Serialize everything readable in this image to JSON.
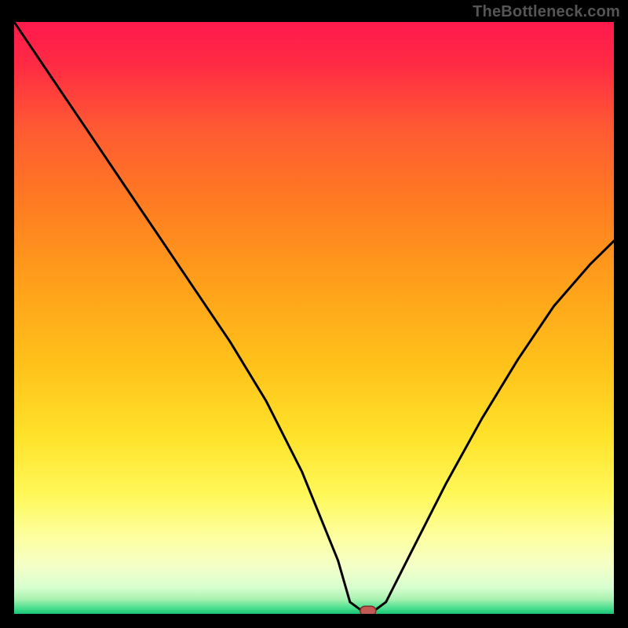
{
  "watermark": "TheBottleneck.com",
  "colors": {
    "frame_bg": "#000000",
    "watermark": "#555555",
    "curve": "#000000",
    "marker_fill": "#c15a55",
    "marker_stroke": "#7a2f2b"
  },
  "gradient_stops": [
    {
      "offset": 0.0,
      "color": "#ff1a4d"
    },
    {
      "offset": 0.07,
      "color": "#ff2a44"
    },
    {
      "offset": 0.18,
      "color": "#ff5a33"
    },
    {
      "offset": 0.3,
      "color": "#ff7a22"
    },
    {
      "offset": 0.45,
      "color": "#ffa21a"
    },
    {
      "offset": 0.58,
      "color": "#ffc21a"
    },
    {
      "offset": 0.7,
      "color": "#ffe22a"
    },
    {
      "offset": 0.8,
      "color": "#fff85a"
    },
    {
      "offset": 0.87,
      "color": "#fdffa0"
    },
    {
      "offset": 0.92,
      "color": "#f4ffc8"
    },
    {
      "offset": 0.955,
      "color": "#d8ffcf"
    },
    {
      "offset": 0.975,
      "color": "#a9f2b0"
    },
    {
      "offset": 0.99,
      "color": "#4bdf8f"
    },
    {
      "offset": 1.0,
      "color": "#17c574"
    }
  ],
  "chart_data": {
    "type": "line",
    "title": "",
    "xlabel": "",
    "ylabel": "",
    "xlim": [
      0,
      100
    ],
    "ylim": [
      0,
      100
    ],
    "grid": false,
    "legend_pos": "none",
    "series": [
      {
        "name": "bottleneck-curve",
        "x": [
          0,
          6,
          12,
          18,
          24,
          30,
          36,
          42,
          48,
          54,
          56,
          58,
          60,
          62,
          66,
          72,
          78,
          84,
          90,
          96,
          100
        ],
        "y": [
          100,
          91,
          82,
          73,
          64,
          55,
          46,
          36,
          24,
          9,
          2,
          0.5,
          0.5,
          2,
          10,
          22,
          33,
          43,
          52,
          59,
          63
        ]
      }
    ],
    "marker": {
      "x": 59,
      "y": 0.5
    }
  }
}
